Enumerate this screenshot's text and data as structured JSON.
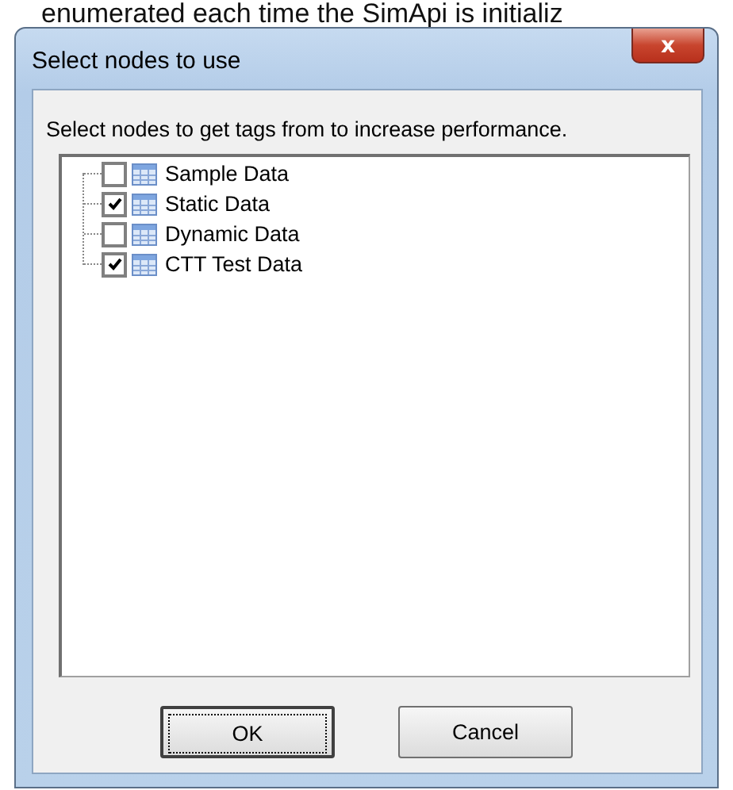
{
  "background_text": "enumerated each time the SimApi is initializ",
  "window": {
    "title": "Select nodes to use",
    "close": "x"
  },
  "instruction": "Select nodes to get tags from to increase performance.",
  "tree": {
    "items": [
      {
        "label": "Sample Data",
        "checked": false
      },
      {
        "label": "Static Data",
        "checked": true
      },
      {
        "label": "Dynamic Data",
        "checked": false
      },
      {
        "label": "CTT Test Data",
        "checked": true
      }
    ]
  },
  "buttons": [
    {
      "label": "OK",
      "default": true
    },
    {
      "label": "Cancel",
      "default": false
    }
  ]
}
